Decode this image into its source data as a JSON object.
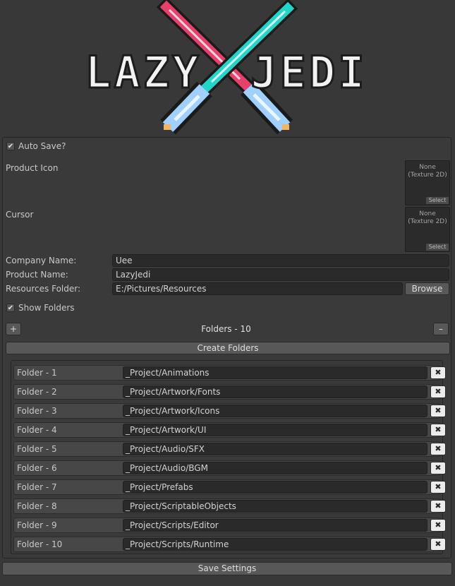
{
  "logo": {
    "left_word": "LAZY",
    "right_word": "JEDI"
  },
  "auto_save": {
    "label": "Auto Save?",
    "checked": true,
    "check_glyph": "✔"
  },
  "product_icon": {
    "label": "Product Icon",
    "value": "None",
    "type": "(Texture 2D)",
    "select_label": "Select"
  },
  "cursor": {
    "label": "Cursor",
    "value": "None",
    "type": "(Texture 2D)",
    "select_label": "Select"
  },
  "company_name": {
    "label": "Company Name:",
    "value": "Uee"
  },
  "product_name": {
    "label": "Product Name:",
    "value": "LazyJedi"
  },
  "resources_folder": {
    "label": "Resources Folder:",
    "value": "E:/Pictures/Resources",
    "browse_label": "Browse"
  },
  "show_folders": {
    "label": "Show Folders",
    "checked": true,
    "check_glyph": "✔"
  },
  "folder_controls": {
    "add_label": "+",
    "count_label": "Folders - 10",
    "remove_label": "–"
  },
  "create_folders_label": "Create Folders",
  "remove_folder_glyph": "✖",
  "folders": [
    {
      "label": "Folder - 1",
      "path": "_Project/Animations"
    },
    {
      "label": "Folder - 2",
      "path": "_Project/Artwork/Fonts"
    },
    {
      "label": "Folder - 3",
      "path": "_Project/Artwork/Icons"
    },
    {
      "label": "Folder - 4",
      "path": "_Project/Artwork/UI"
    },
    {
      "label": "Folder - 5",
      "path": "_Project/Audio/SFX"
    },
    {
      "label": "Folder - 6",
      "path": "_Project/Audio/BGM"
    },
    {
      "label": "Folder - 7",
      "path": "_Project/Prefabs"
    },
    {
      "label": "Folder - 8",
      "path": "_Project/ScriptableObjects"
    },
    {
      "label": "Folder - 9",
      "path": "_Project/Scripts/Editor"
    },
    {
      "label": "Folder - 10",
      "path": "_Project/Scripts/Runtime"
    }
  ],
  "save_settings_label": "Save Settings",
  "colors": {
    "saber_red": "#e8406a",
    "saber_cyan": "#1fd6c8",
    "hilt_blue": "#9fd0ff"
  }
}
